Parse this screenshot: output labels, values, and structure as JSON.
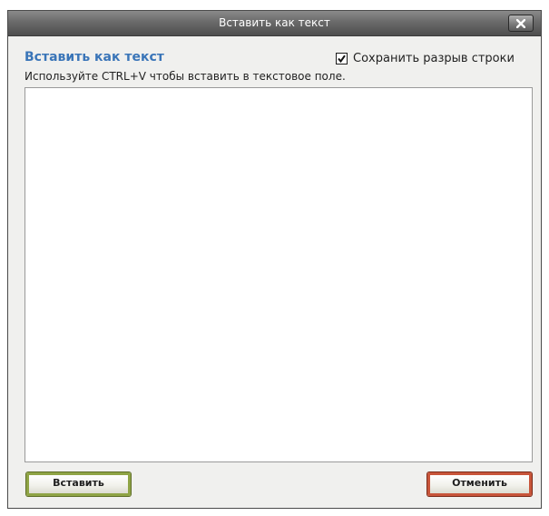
{
  "window": {
    "title": "Вставить как текст",
    "close_icon": "close-x-icon"
  },
  "dialog": {
    "heading": "Вставить как текст",
    "keep_line_breaks": {
      "label": "Сохранить разрыв строки",
      "checked": true
    },
    "hint": "Используйте CTRL+V чтобы вставить в текстовое поле.",
    "text_value": ""
  },
  "buttons": {
    "insert_label": "Вставить",
    "cancel_label": "Отменить"
  },
  "colors": {
    "heading": "#3a75b8",
    "insert_border": "#8fa445",
    "cancel_border": "#c8553a",
    "titlebar": "#6a6a6a"
  }
}
